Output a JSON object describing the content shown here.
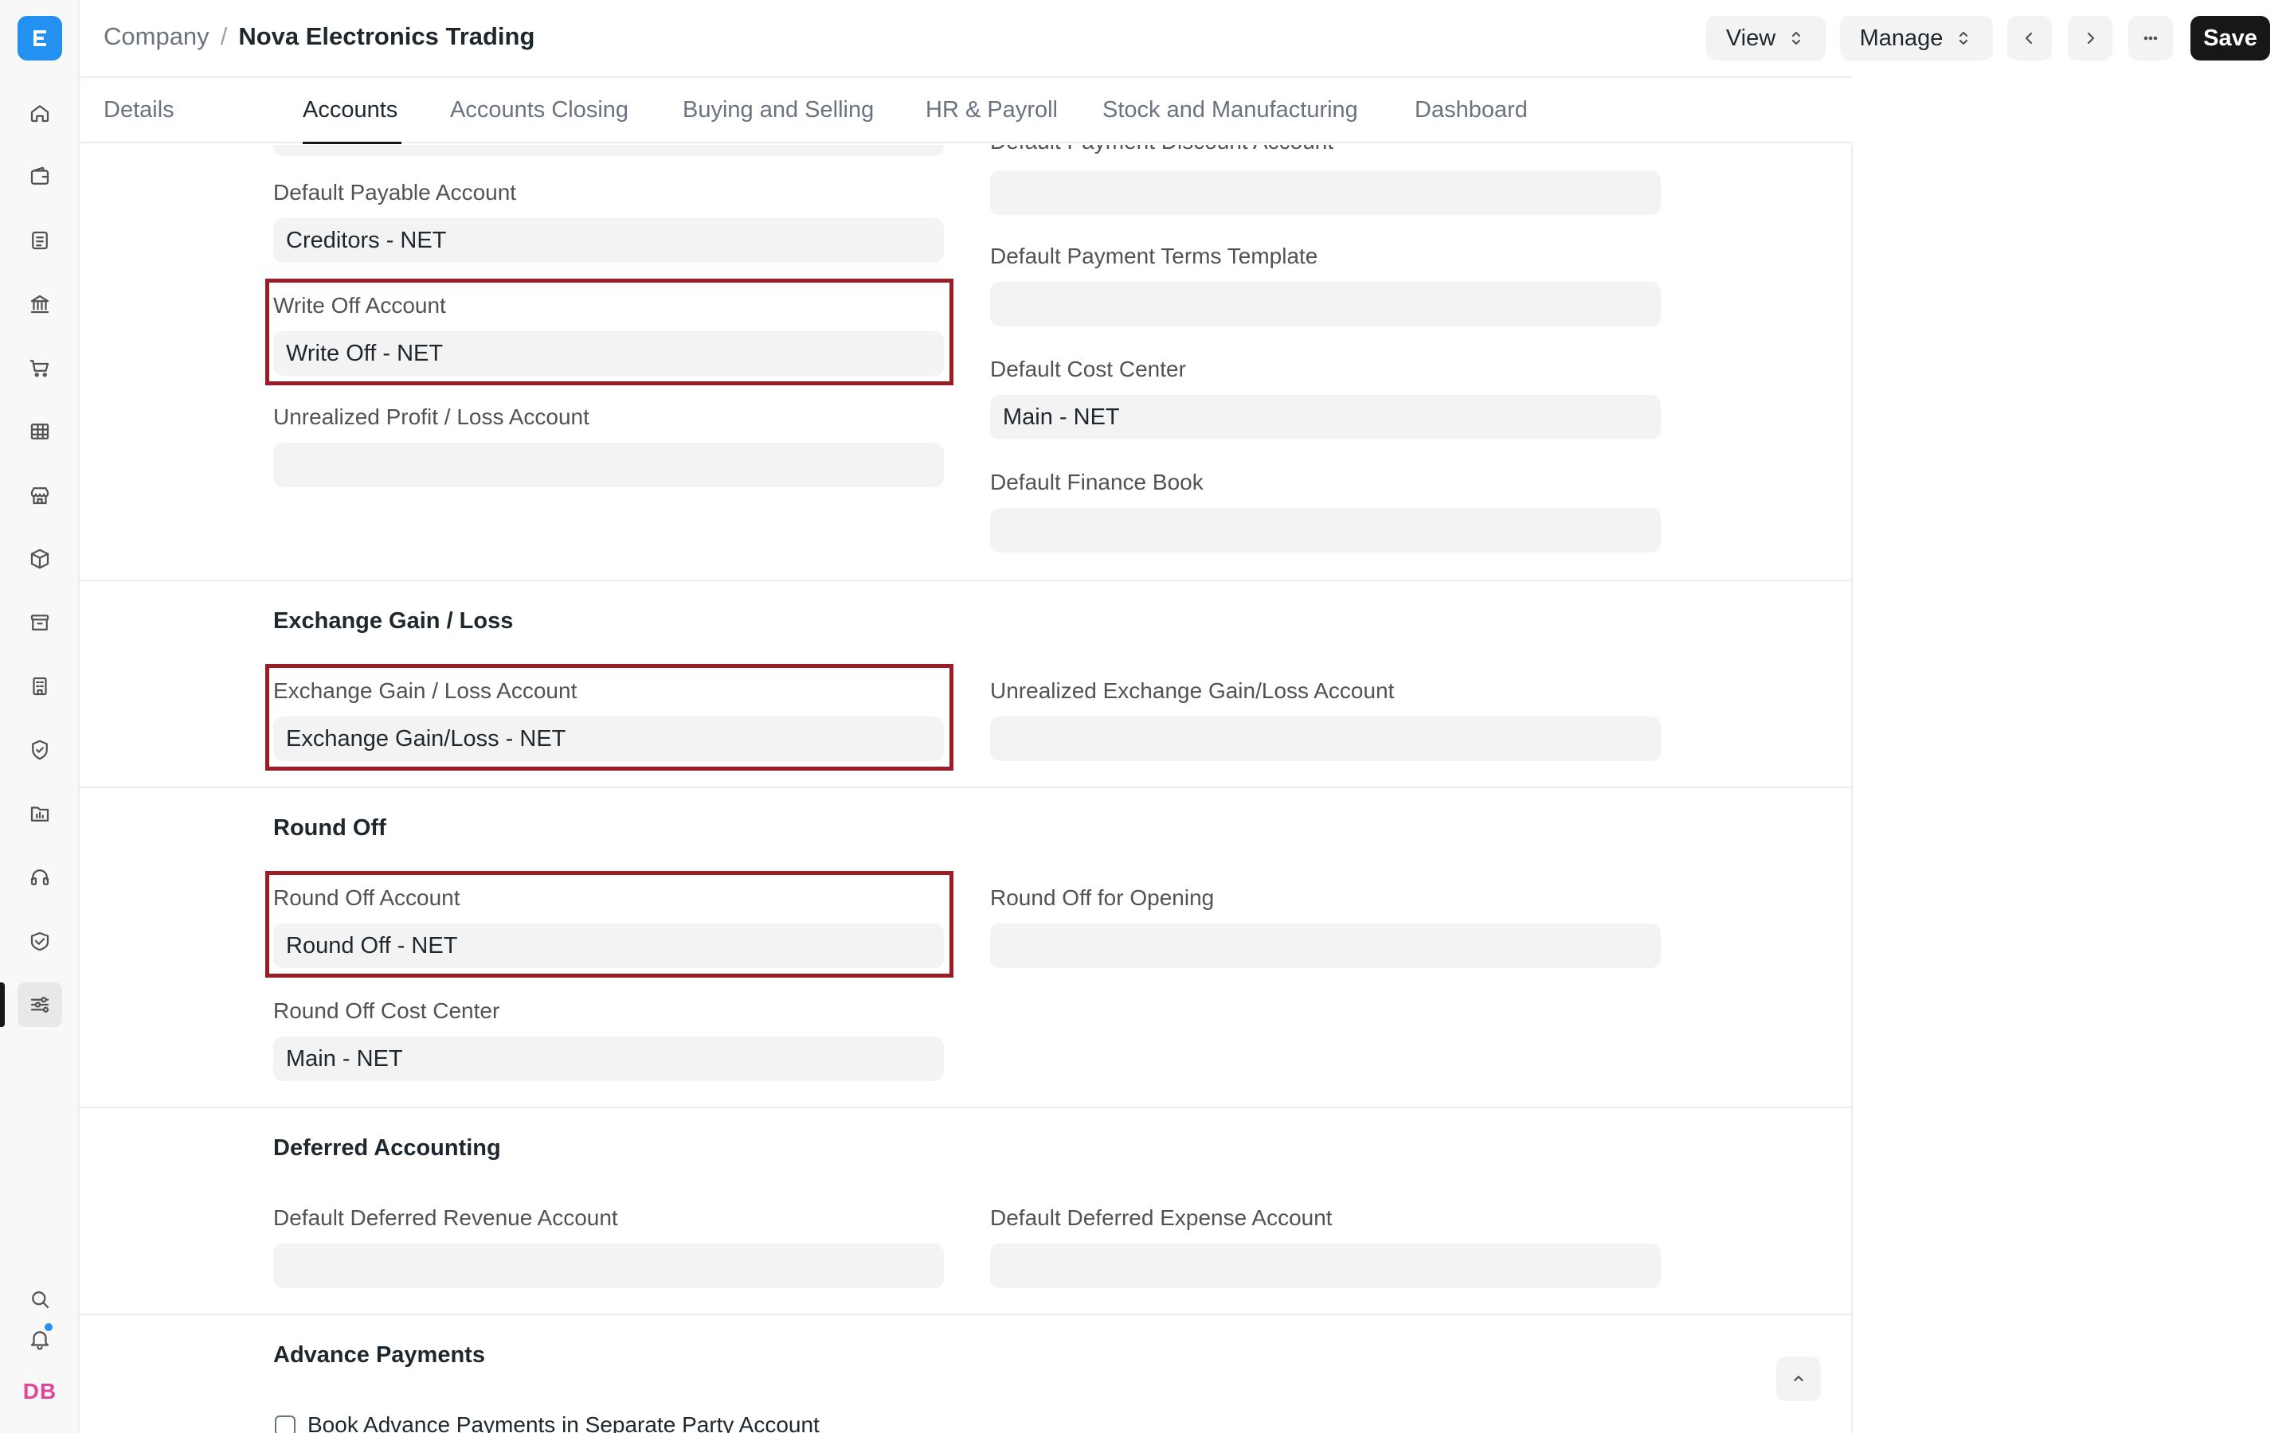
{
  "app": {
    "breadcrumb_parent": "Company",
    "breadcrumb_sep": "/",
    "breadcrumb_current": "Nova Electronics Trading",
    "avatar_initials": "DB"
  },
  "header": {
    "view_label": "View",
    "manage_label": "Manage",
    "save_label": "Save"
  },
  "tabs": [
    {
      "label": "Details"
    },
    {
      "label": "Accounts"
    },
    {
      "label": "Accounts Closing"
    },
    {
      "label": "Buying and Selling"
    },
    {
      "label": "HR & Payroll"
    },
    {
      "label": "Stock and Manufacturing"
    },
    {
      "label": "Dashboard"
    }
  ],
  "active_tab": "Accounts",
  "sidebar_icons": [
    "home-icon",
    "wallet-icon",
    "document-icon",
    "bank-icon",
    "cart-icon",
    "table-icon",
    "store-icon",
    "box-icon",
    "archive-icon",
    "building-icon",
    "shield-icon",
    "folder-chart-icon",
    "headset-icon",
    "handshake-icon",
    "settings-sliders-icon"
  ],
  "fields": {
    "default_payment_discount_account": {
      "label": "Default Payment Discount Account",
      "value": ""
    },
    "default_payable_account": {
      "label": "Default Payable Account",
      "value": "Creditors - NET"
    },
    "default_payment_terms_template": {
      "label": "Default Payment Terms Template",
      "value": ""
    },
    "write_off_account": {
      "label": "Write Off Account",
      "value": "Write Off - NET"
    },
    "default_cost_center": {
      "label": "Default Cost Center",
      "value": "Main - NET"
    },
    "unrealized_profit_loss_account": {
      "label": "Unrealized Profit / Loss Account",
      "value": ""
    },
    "default_finance_book": {
      "label": "Default Finance Book",
      "value": ""
    },
    "exchange_gain_loss_account": {
      "label": "Exchange Gain / Loss Account",
      "value": "Exchange Gain/Loss - NET"
    },
    "unrealized_exchange_gain_loss_account": {
      "label": "Unrealized Exchange Gain/Loss Account",
      "value": ""
    },
    "round_off_account": {
      "label": "Round Off Account",
      "value": "Round Off - NET"
    },
    "round_off_for_opening": {
      "label": "Round Off for Opening",
      "value": ""
    },
    "round_off_cost_center": {
      "label": "Round Off Cost Center",
      "value": "Main - NET"
    },
    "default_deferred_revenue_account": {
      "label": "Default Deferred Revenue Account",
      "value": ""
    },
    "default_deferred_expense_account": {
      "label": "Default Deferred Expense Account",
      "value": ""
    }
  },
  "sections": {
    "exchange_gain_loss": "Exchange Gain / Loss",
    "round_off": "Round Off",
    "deferred_accounting": "Deferred Accounting",
    "advance_payments": "Advance Payments"
  },
  "checkboxes": {
    "book_advance_payments": {
      "label": "Book Advance Payments in Separate Party Account",
      "checked": false
    }
  },
  "colors": {
    "highlight": "#9b1c24",
    "brand": "#2490ef",
    "primary_button": "#171717",
    "avatar_text": "#e0469c"
  }
}
